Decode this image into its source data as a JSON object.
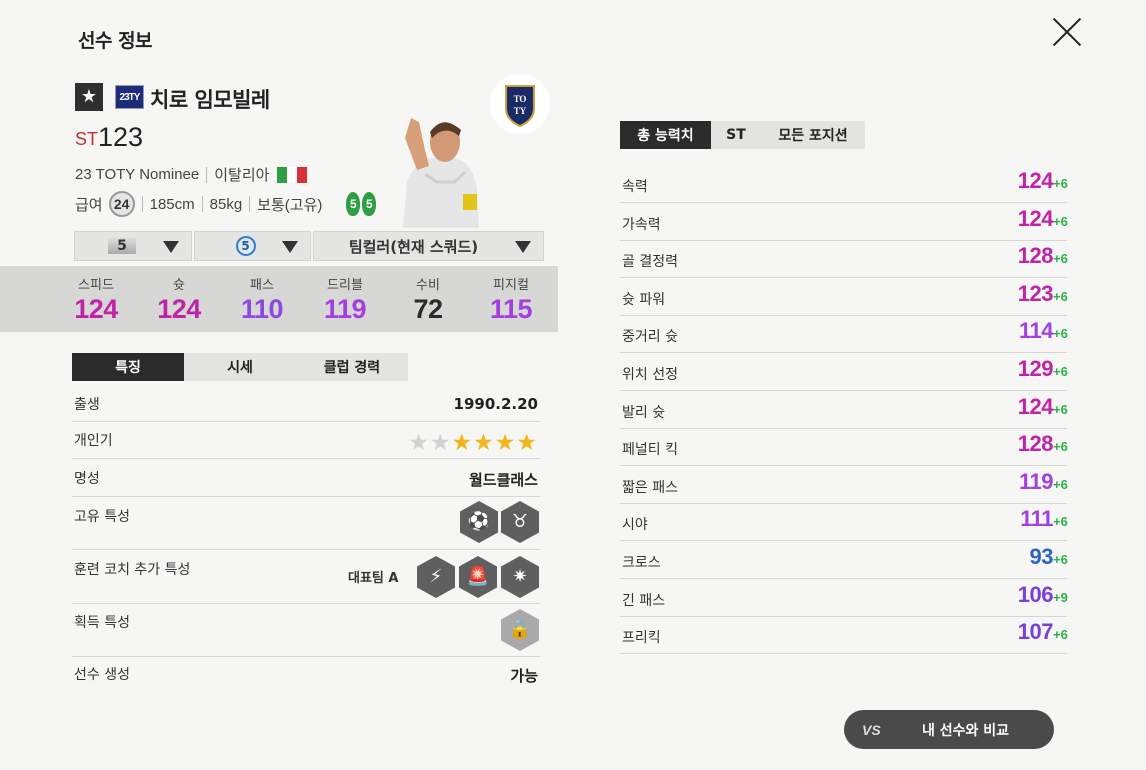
{
  "header": {
    "title": "선수 정보"
  },
  "player": {
    "season_badge": "23TY",
    "name": "치로 임모빌레",
    "position": "ST",
    "ovr": "123",
    "season_name": "23 TOTY Nominee",
    "nation": "이탈리아",
    "pay_label": "급여",
    "pay": "24",
    "height": "185cm",
    "weight": "85kg",
    "body_type": "보통(고유)",
    "left_foot": "5",
    "right_foot": "5",
    "colors": {
      "flag_green": "#2f9e44",
      "flag_white": "#ffffff",
      "flag_red": "#d8313a"
    }
  },
  "dropdowns": {
    "grade": "5",
    "level": "5",
    "team_color": "팀컬러(현재 스쿼드)"
  },
  "summary_stats": [
    {
      "label": "스피드",
      "value": "124",
      "color": "#c023a8"
    },
    {
      "label": "슛",
      "value": "124",
      "color": "#c023a8"
    },
    {
      "label": "패스",
      "value": "110",
      "color": "#8e47e0"
    },
    {
      "label": "드리블",
      "value": "119",
      "color": "#a33ee0"
    },
    {
      "label": "수비",
      "value": "72",
      "color": "#2b2b2b"
    },
    {
      "label": "피지컬",
      "value": "115",
      "color": "#a33ee0"
    }
  ],
  "left_tabs": [
    "특징",
    "시세",
    "클럽 경력"
  ],
  "traits": {
    "birth_label": "출생",
    "birth": "1990.2.20",
    "popularity_label": "개인기",
    "popularity_stars_on": 4,
    "popularity_stars_total": 6,
    "reputation_label": "명성",
    "reputation": "월드클래스",
    "unique_label": "고유 특성",
    "coach_label": "훈련 코치 추가 특성",
    "coach_value": "대표팀 A",
    "acquired_label": "획득 특성",
    "creation_label": "선수 생성",
    "creation": "가능"
  },
  "right_tabs": [
    "총 능력치",
    "ST",
    "모든 포지션"
  ],
  "detail_stats": [
    {
      "label": "속력",
      "value": "124",
      "bonus": "+6",
      "color": "#c023a8"
    },
    {
      "label": "가속력",
      "value": "124",
      "bonus": "+6",
      "color": "#c023a8"
    },
    {
      "label": "골 결정력",
      "value": "128",
      "bonus": "+6",
      "color": "#c023a8"
    },
    {
      "label": "슛 파워",
      "value": "123",
      "bonus": "+6",
      "color": "#c023a8"
    },
    {
      "label": "중거리 슛",
      "value": "114",
      "bonus": "+6",
      "color": "#a33ee0"
    },
    {
      "label": "위치 선정",
      "value": "129",
      "bonus": "+6",
      "color": "#c023a8"
    },
    {
      "label": "발리 슛",
      "value": "124",
      "bonus": "+6",
      "color": "#c023a8"
    },
    {
      "label": "페널티 킥",
      "value": "128",
      "bonus": "+6",
      "color": "#c023a8"
    },
    {
      "label": "짧은 패스",
      "value": "119",
      "bonus": "+6",
      "color": "#a33ee0"
    },
    {
      "label": "시야",
      "value": "111",
      "bonus": "+6",
      "color": "#a33ee0"
    },
    {
      "label": "크로스",
      "value": "93",
      "bonus": "+6",
      "color": "#2b63c4"
    },
    {
      "label": "긴 패스",
      "value": "106",
      "bonus": "+9",
      "color": "#7a3ee0"
    },
    {
      "label": "프리킥",
      "value": "107",
      "bonus": "+6",
      "color": "#7a3ee0"
    }
  ],
  "compare_button": {
    "icon_text": "VS",
    "label": "내 선수와 비교"
  }
}
